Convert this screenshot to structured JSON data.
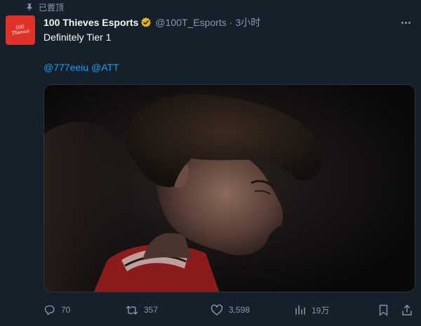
{
  "pinned": {
    "label": "已置顶",
    "icon": "pin-icon"
  },
  "tweet": {
    "avatar": {
      "logo_text_line1": "100",
      "logo_text_line2": "Thieves",
      "background": "#e1322a"
    },
    "author": {
      "display_name": "100 Thieves Esports",
      "verified_badge": "verified-gold-icon",
      "badge_color": "#e2b719",
      "handle": "@100T_Esports",
      "separator": "·",
      "time": "3小时"
    },
    "text": "Definitely Tier 1",
    "mentions": [
      "@777eeiu",
      "@ATT"
    ],
    "media": {
      "type": "photo",
      "icon": "photo-media"
    },
    "actions": {
      "replies": "70",
      "retweets": "357",
      "likes": "3,598",
      "views": "19万"
    }
  },
  "colors": {
    "background": "#15202b",
    "text_primary": "#f7f9f9",
    "text_secondary": "#8b98a5",
    "link": "#1d9bf0"
  }
}
